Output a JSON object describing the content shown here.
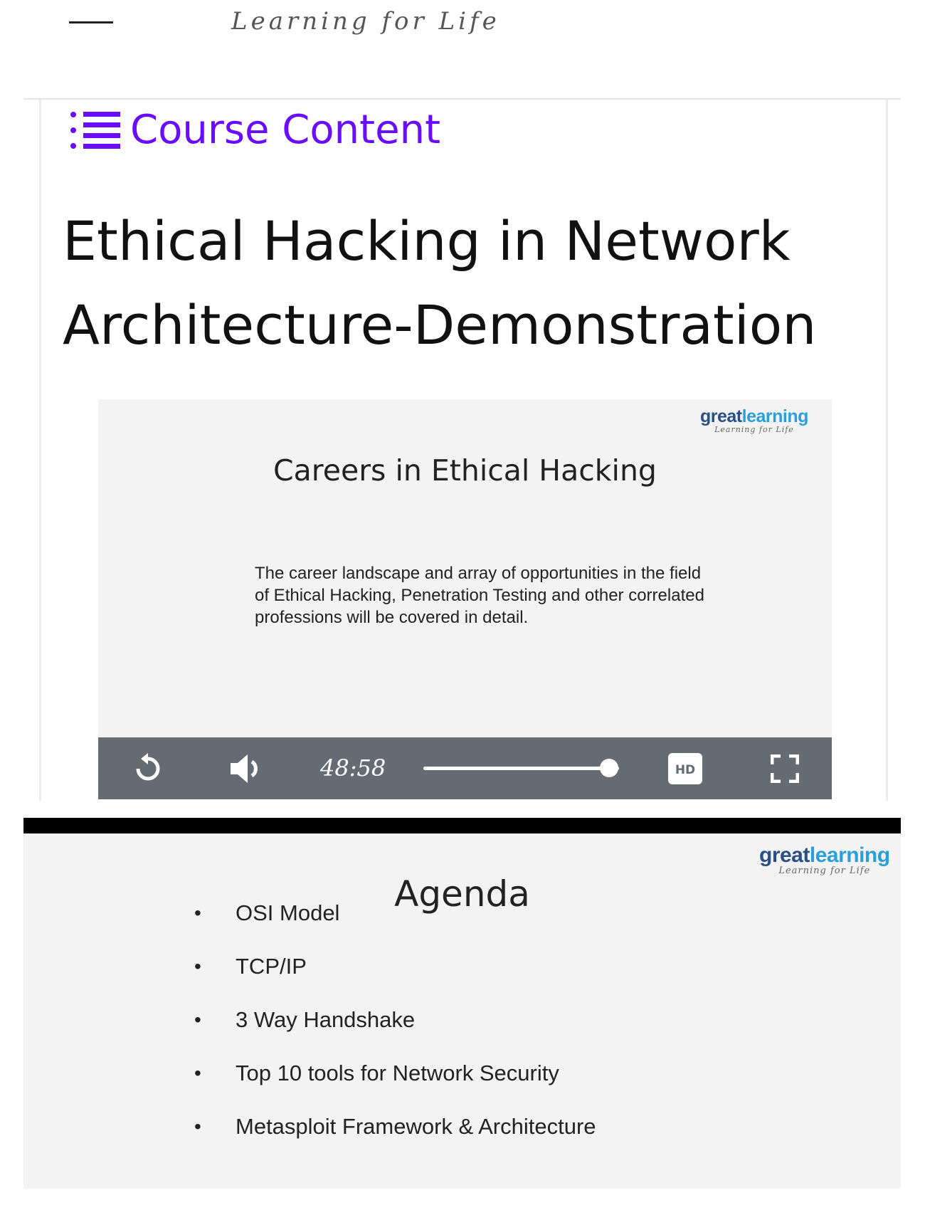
{
  "header": {
    "tagline": "Learning for Life"
  },
  "course_content": {
    "label": "Course Content",
    "icon": "list-icon",
    "color": "#6a0dff"
  },
  "lesson": {
    "title": "Ethical Hacking in Network Architecture-Demonstration"
  },
  "video": {
    "logo_brand_part1": "great",
    "logo_brand_part2": "learning",
    "logo_sub": "Learning for Life",
    "slide_title": "Careers in Ethical Hacking",
    "slide_text": "The career landscape and array of opportunities in the field of Ethical Hacking, Penetration Testing and other correlated professions will be covered in detail.",
    "controls": {
      "time": "48:58",
      "progress": 0.95,
      "hd_label": "HD",
      "icons": [
        "replay-icon",
        "volume-icon",
        "hd-icon",
        "fullscreen-icon"
      ]
    }
  },
  "second_slide": {
    "logo_brand_part1": "great",
    "logo_brand_part2": "learning",
    "logo_sub": "Learning for Life",
    "title": "Agenda",
    "items": [
      "OSI Model",
      "TCP/IP",
      "3 Way Handshake",
      "Top 10 tools for Network Security",
      "Metasploit Framework & Architecture"
    ]
  }
}
